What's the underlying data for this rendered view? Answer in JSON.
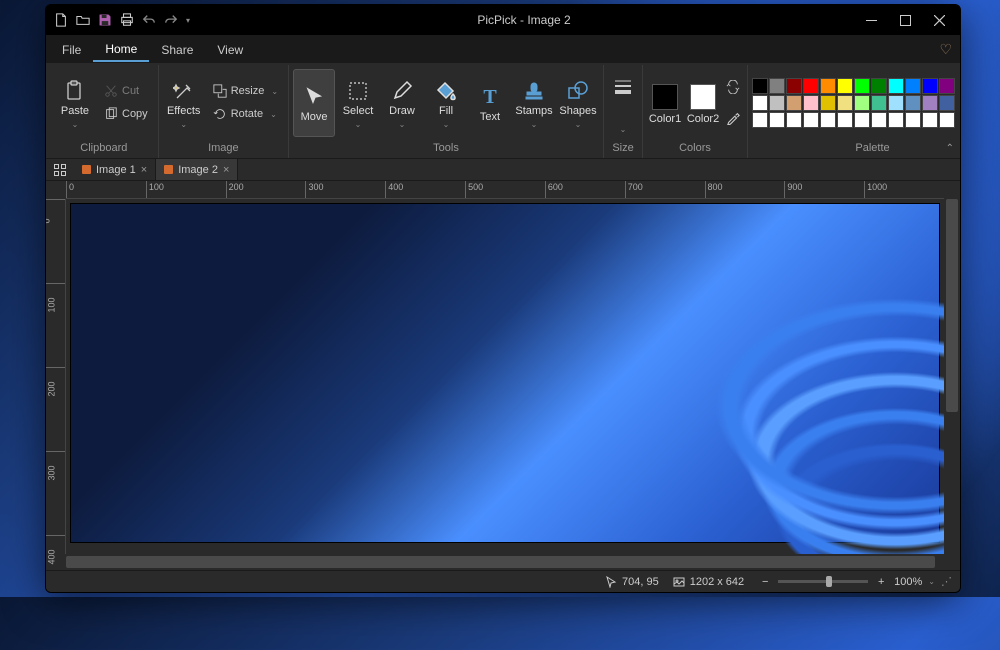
{
  "titlebar": {
    "title": "PicPick - Image 2"
  },
  "menutabs": {
    "file": "File",
    "home": "Home",
    "share": "Share",
    "view": "View"
  },
  "ribbon": {
    "clipboard": {
      "label": "Clipboard",
      "paste": "Paste",
      "cut": "Cut",
      "copy": "Copy"
    },
    "image": {
      "label": "Image",
      "effects": "Effects",
      "resize": "Resize",
      "rotate": "Rotate"
    },
    "tools": {
      "label": "Tools",
      "move": "Move",
      "select": "Select",
      "draw": "Draw",
      "fill": "Fill",
      "text": "Text",
      "stamps": "Stamps",
      "shapes": "Shapes"
    },
    "size": {
      "label": "Size"
    },
    "colors": {
      "label": "Colors",
      "c1": "Color1",
      "c2": "Color2",
      "c1_value": "#000000",
      "c2_value": "#ffffff"
    },
    "palette": {
      "label": "Palette",
      "more": "More",
      "row1": [
        "#000000",
        "#808080",
        "#8b0000",
        "#ff0000",
        "#ff8c00",
        "#ffff00",
        "#00ff00",
        "#008000",
        "#00ffff",
        "#0080ff",
        "#0000ff",
        "#800080"
      ],
      "row2": [
        "#ffffff",
        "#c0c0c0",
        "#d2a070",
        "#ffc0cb",
        "#e0c000",
        "#f0e080",
        "#a0ff80",
        "#40c090",
        "#a0e0ff",
        "#6090c0",
        "#a080c0",
        "#4060a0"
      ],
      "row3": [
        "#ffffff",
        "#ffffff",
        "#ffffff",
        "#ffffff",
        "#ffffff",
        "#ffffff",
        "#ffffff",
        "#ffffff",
        "#ffffff",
        "#ffffff",
        "#ffffff",
        "#ffffff"
      ]
    }
  },
  "doctabs": {
    "t1": "Image 1",
    "t2": "Image 2"
  },
  "ruler_h": [
    "0",
    "100",
    "200",
    "300",
    "400",
    "500",
    "600",
    "700",
    "800",
    "900",
    "1000"
  ],
  "ruler_v": [
    "0",
    "100",
    "200",
    "300",
    "400"
  ],
  "status": {
    "cursor_pos": "704, 95",
    "dimensions": "1202 x 642",
    "zoom": "100%"
  }
}
